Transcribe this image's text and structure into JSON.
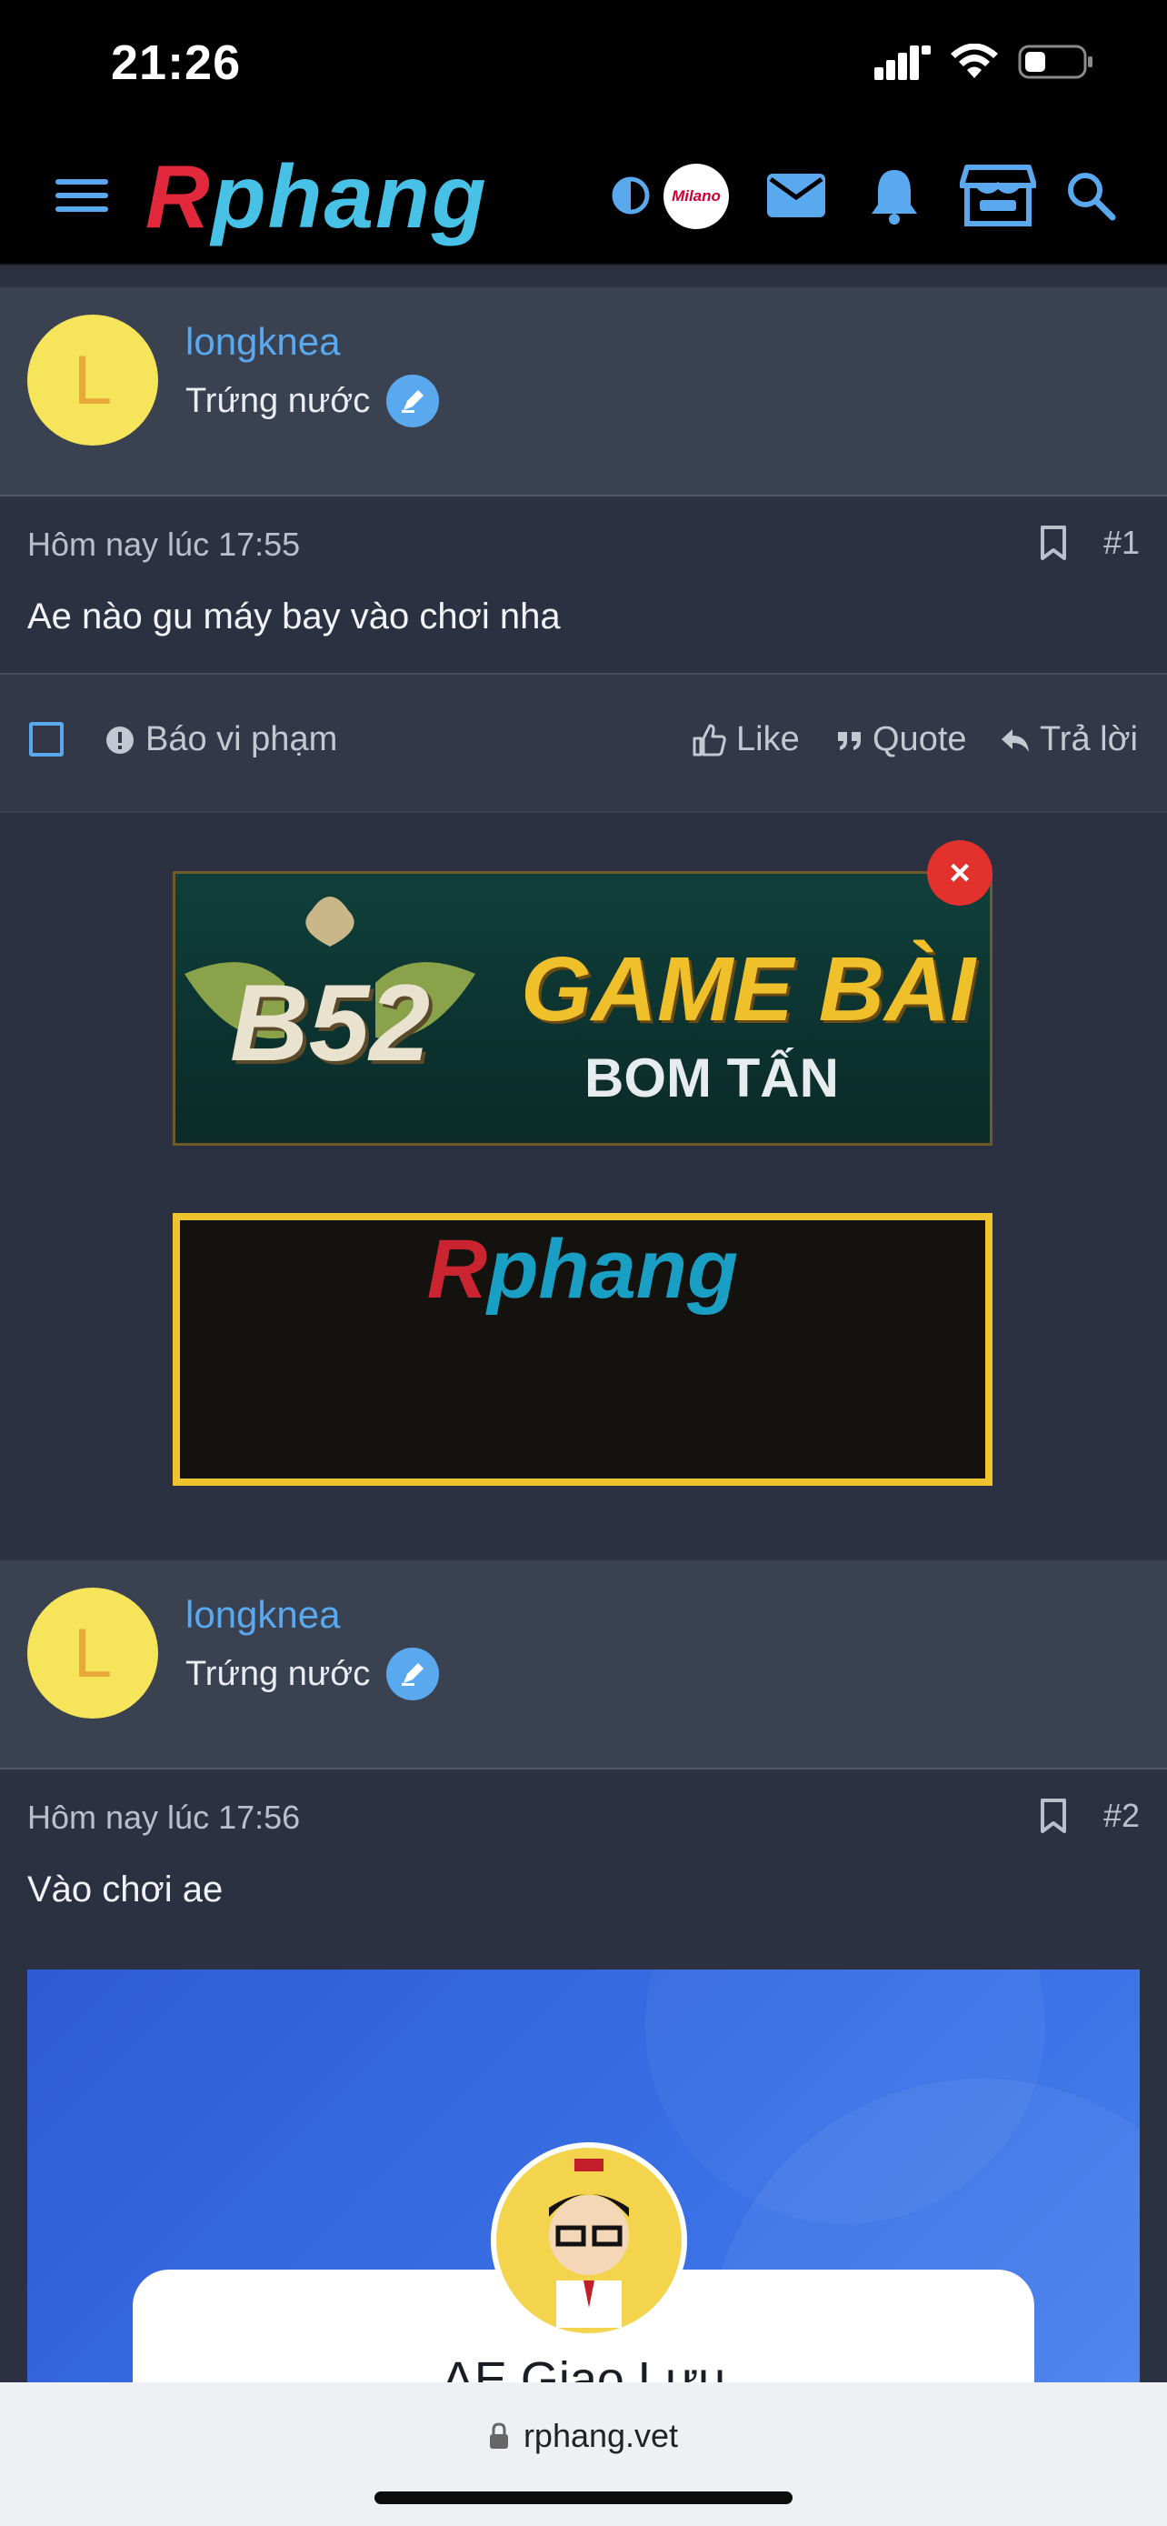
{
  "status": {
    "time": "21:26"
  },
  "header": {
    "logo": "Rphang",
    "partner_label": "Milano"
  },
  "posts": [
    {
      "username": "longknea",
      "user_title": "Trứng nước",
      "avatar_letter": "L",
      "timestamp": "Hôm nay lúc 17:55",
      "number": "#1",
      "body": "Ae nào gu máy bay vào chơi nha",
      "actions": {
        "report": "Báo vi phạm",
        "like": "Like",
        "quote": "Quote",
        "reply": "Trả lời"
      }
    },
    {
      "username": "longknea",
      "user_title": "Trứng nước",
      "avatar_letter": "L",
      "timestamp": "Hôm nay lúc 17:56",
      "number": "#2",
      "body": "Vào chơi ae",
      "embed_title": "AE Giao Lưu"
    }
  ],
  "ads": {
    "b52_line1": "B52",
    "b52_line2": "GAME BÀI",
    "b52_line3": "BOM TẤN",
    "rphang_logo": "Rphang",
    "close_label": "×"
  },
  "browser": {
    "url": "rphang.vet"
  },
  "colors": {
    "accent": "#5aa9ef",
    "header_bg": "#000000",
    "page_bg": "#2b3140",
    "user_bar_bg": "#3a4150"
  }
}
